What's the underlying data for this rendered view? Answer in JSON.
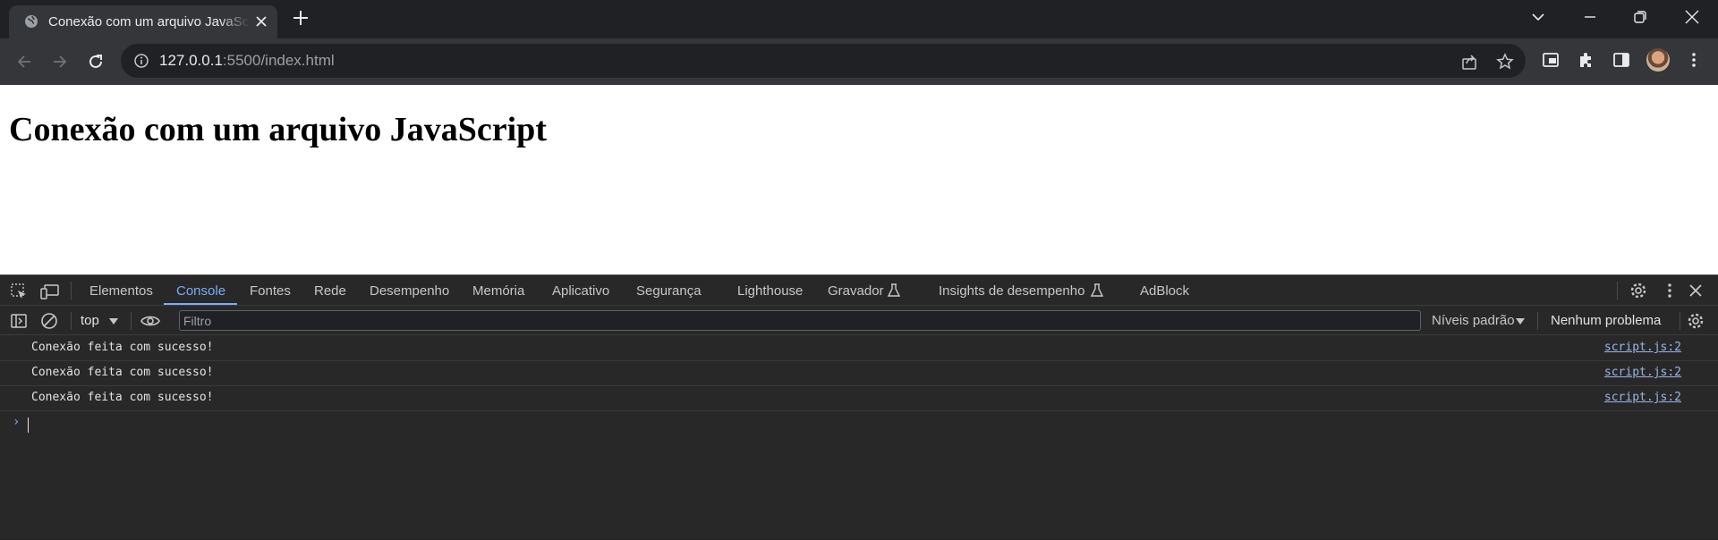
{
  "browser": {
    "tab": {
      "title": "Conexão com um arquivo JavaScript",
      "favicon": "globe-icon"
    },
    "window_controls": [
      "chevron-down-icon",
      "minimize-icon",
      "restore-icon",
      "close-icon"
    ],
    "address": {
      "host": "127.0.0.1",
      "port_path": ":5500/index.html"
    }
  },
  "page": {
    "heading": "Conexão com um arquivo JavaScript"
  },
  "devtools": {
    "tabs": [
      {
        "label": "Elementos",
        "active": false
      },
      {
        "label": "Console",
        "active": true
      },
      {
        "label": "Fontes",
        "active": false
      },
      {
        "label": "Rede",
        "active": false
      },
      {
        "label": "Desempenho",
        "active": false
      },
      {
        "label": "Memória",
        "active": false
      },
      {
        "label": "Aplicativo",
        "active": false
      },
      {
        "label": "Segurança",
        "active": false
      },
      {
        "label": "Lighthouse",
        "active": false
      },
      {
        "label": "Gravador",
        "active": false
      },
      {
        "label": "Insights de desempenho",
        "active": false
      },
      {
        "label": "AdBlock",
        "active": false
      }
    ],
    "console": {
      "context": "top",
      "filter_placeholder": "Filtro",
      "levels": "Níveis padrão",
      "issues": "Nenhum problema",
      "messages": [
        {
          "text": "Conexão feita com sucesso!",
          "source": "script.js:2"
        },
        {
          "text": "Conexão feita com sucesso!",
          "source": "script.js:2"
        },
        {
          "text": "Conexão feita com sucesso!",
          "source": "script.js:2"
        }
      ]
    }
  },
  "colors": {
    "accent": "#7cacf8",
    "chrome_dark": "#202124",
    "toolbar": "#35363a",
    "devtools_bg": "#282828"
  }
}
